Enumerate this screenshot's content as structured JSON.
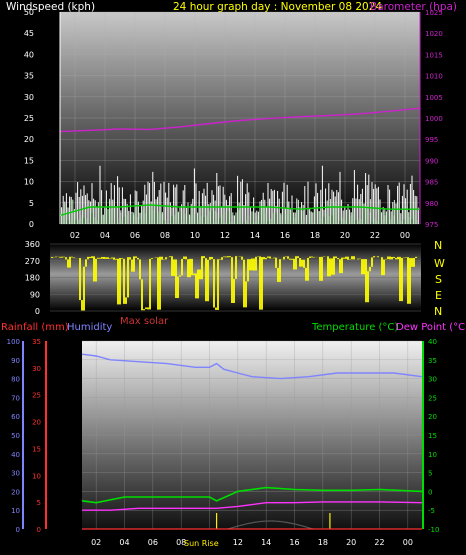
{
  "header": {
    "left_label": "Windspeed (kph)",
    "center_label": "24 hour graph day : November 08 2024",
    "right_label": "Barometer (hpa)"
  },
  "time_ticks": [
    "02",
    "04",
    "06",
    "08",
    "10",
    "12",
    "14",
    "16",
    "18",
    "20",
    "22",
    "00"
  ],
  "colors": {
    "wind": "#ffffff",
    "gust_fill": "#c8f0c8",
    "wind_avg": "#00cc00",
    "barometer": "#cc22cc",
    "direction": "#ffff00",
    "rain": "#ff3030",
    "humidity": "#7f84ff",
    "temperature": "#00dd00",
    "dewpoint": "#ff33ff",
    "solar": "#cc3333",
    "sunrise": "#ffee00"
  },
  "chart_data": [
    {
      "type": "line",
      "name": "wind-barometer",
      "x_hours_range": [
        1,
        25
      ],
      "y_left": {
        "title": "Windspeed (kph)",
        "ticks": [
          "0",
          "5",
          "10",
          "15",
          "20",
          "25",
          "30",
          "35",
          "40",
          "45",
          "50"
        ],
        "ylim": [
          0,
          50
        ]
      },
      "y_right": {
        "title": "Barometer (hpa)",
        "ticks": [
          "975",
          "980",
          "985",
          "990",
          "995",
          "1000",
          "1005",
          "1010",
          "1015",
          "1020",
          "1025"
        ],
        "ylim": [
          975,
          1025
        ]
      },
      "series": [
        {
          "key": "barometer",
          "values_at_hours": [
            [
              1,
              996.8
            ],
            [
              3,
              997.1
            ],
            [
              5,
              997.4
            ],
            [
              7,
              997.3
            ],
            [
              9,
              997.9
            ],
            [
              11,
              998.7
            ],
            [
              13,
              999.4
            ],
            [
              15,
              999.9
            ],
            [
              17,
              1000.3
            ],
            [
              19,
              1000.6
            ],
            [
              21,
              1001.0
            ],
            [
              23,
              1001.6
            ],
            [
              25,
              1002.3
            ]
          ]
        },
        {
          "key": "wind_avg",
          "values_at_hours": [
            [
              1,
              2
            ],
            [
              3,
              4
            ],
            [
              5,
              4
            ],
            [
              7,
              4.5
            ],
            [
              9,
              4
            ],
            [
              11,
              4
            ],
            [
              13,
              4
            ],
            [
              15,
              4
            ],
            [
              17,
              3.5
            ],
            [
              19,
              4
            ],
            [
              21,
              4
            ],
            [
              23,
              3.5
            ],
            [
              25,
              3.5
            ]
          ]
        }
      ]
    },
    {
      "type": "scatter",
      "name": "wind-direction",
      "y_left": {
        "ticks": [
          "0",
          "90",
          "180",
          "270",
          "360"
        ],
        "ylim": [
          0,
          360
        ]
      },
      "y_right": {
        "ticks": [
          "N",
          "W",
          "S",
          "E",
          "N"
        ]
      },
      "baseline_deg": 285
    },
    {
      "type": "line",
      "name": "temp-humidity-rain",
      "x_hours_range": [
        1,
        25
      ],
      "y_humidity": {
        "title": "Humidity",
        "ticks": [
          "0",
          "10",
          "20",
          "30",
          "40",
          "50",
          "60",
          "70",
          "80",
          "90",
          "100"
        ],
        "ylim": [
          0,
          100
        ]
      },
      "y_rain": {
        "title": "Rainfall (mm)",
        "ticks": [
          "0",
          "5",
          "10",
          "15",
          "20",
          "25",
          "30",
          "35"
        ],
        "ylim": [
          0,
          35
        ]
      },
      "y_temp": {
        "title": "Temperature (°C)",
        "ticks": [
          "-10",
          "-5",
          "0",
          "5",
          "10",
          "15",
          "20",
          "25",
          "30",
          "35",
          "40"
        ],
        "ylim": [
          -10,
          40
        ]
      },
      "series": [
        {
          "key": "humidity",
          "values_at_hours": [
            [
              1,
              93
            ],
            [
              2,
              92
            ],
            [
              3,
              90
            ],
            [
              5,
              89
            ],
            [
              7,
              88
            ],
            [
              9,
              86
            ],
            [
              10,
              86
            ],
            [
              10.5,
              88
            ],
            [
              11,
              85
            ],
            [
              12,
              83
            ],
            [
              13,
              81
            ],
            [
              15,
              80
            ],
            [
              17,
              81
            ],
            [
              19,
              83
            ],
            [
              21,
              83
            ],
            [
              23,
              83
            ],
            [
              25,
              81
            ]
          ]
        },
        {
          "key": "temperature",
          "values_at_hours": [
            [
              1,
              -2.5
            ],
            [
              2,
              -3
            ],
            [
              4,
              -1.5
            ],
            [
              6,
              -1.5
            ],
            [
              8,
              -1.5
            ],
            [
              10,
              -1.5
            ],
            [
              10.5,
              -2.5
            ],
            [
              12,
              0
            ],
            [
              14,
              1
            ],
            [
              16,
              0.5
            ],
            [
              18,
              0.3
            ],
            [
              20,
              0.3
            ],
            [
              22,
              0.5
            ],
            [
              25,
              0
            ]
          ]
        },
        {
          "key": "dewpoint",
          "values_at_hours": [
            [
              1,
              -5
            ],
            [
              3,
              -5
            ],
            [
              5,
              -4.5
            ],
            [
              7,
              -4.5
            ],
            [
              9,
              -4.5
            ],
            [
              10.5,
              -4.5
            ],
            [
              12,
              -4
            ],
            [
              14,
              -3
            ],
            [
              16,
              -3
            ],
            [
              18,
              -2.8
            ],
            [
              20,
              -2.8
            ],
            [
              22,
              -2.8
            ],
            [
              25,
              -3
            ]
          ]
        },
        {
          "key": "rain",
          "values_at_hours": [
            [
              1,
              0
            ],
            [
              25,
              0
            ]
          ]
        }
      ],
      "solar_peak_hour": 13,
      "sun_rise_hour": 10.5,
      "sun_set_hour": 18.5
    }
  ],
  "mid_labels": {
    "rainfall": "Rainfall (mm)",
    "humidity": "Humidity",
    "max_solar": "Max solar",
    "temperature": "Temperature (°C)",
    "dewpoint": "Dew Point (°C)",
    "sun_rise": "Sun Rise"
  }
}
